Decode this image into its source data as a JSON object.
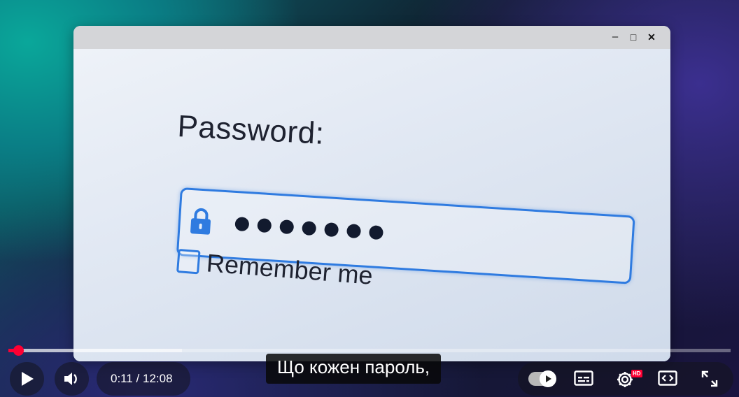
{
  "window": {
    "controls": {
      "minimize": "–",
      "maximize": "□",
      "close": "✕"
    }
  },
  "login": {
    "password_label": "Password:",
    "password_value": "•••••••",
    "password_dot_count": 7,
    "remember_label": "Remember me",
    "remember_checked": false
  },
  "player": {
    "time_current": "0:11",
    "time_total": "12:08",
    "time_display": "0:11 / 12:08",
    "progress_fraction": 0.015,
    "buffered_fraction": 0.24,
    "subtitle": "Що кожен пароль,",
    "hd_badge": "HD",
    "icons": [
      "play-icon",
      "volume-icon",
      "autoplay-toggle-icon",
      "subtitles-icon",
      "settings-icon",
      "miniplayer-icon",
      "fullscreen-icon"
    ]
  },
  "colors": {
    "accent": "#2f7be0",
    "progress": "#ff0033"
  }
}
